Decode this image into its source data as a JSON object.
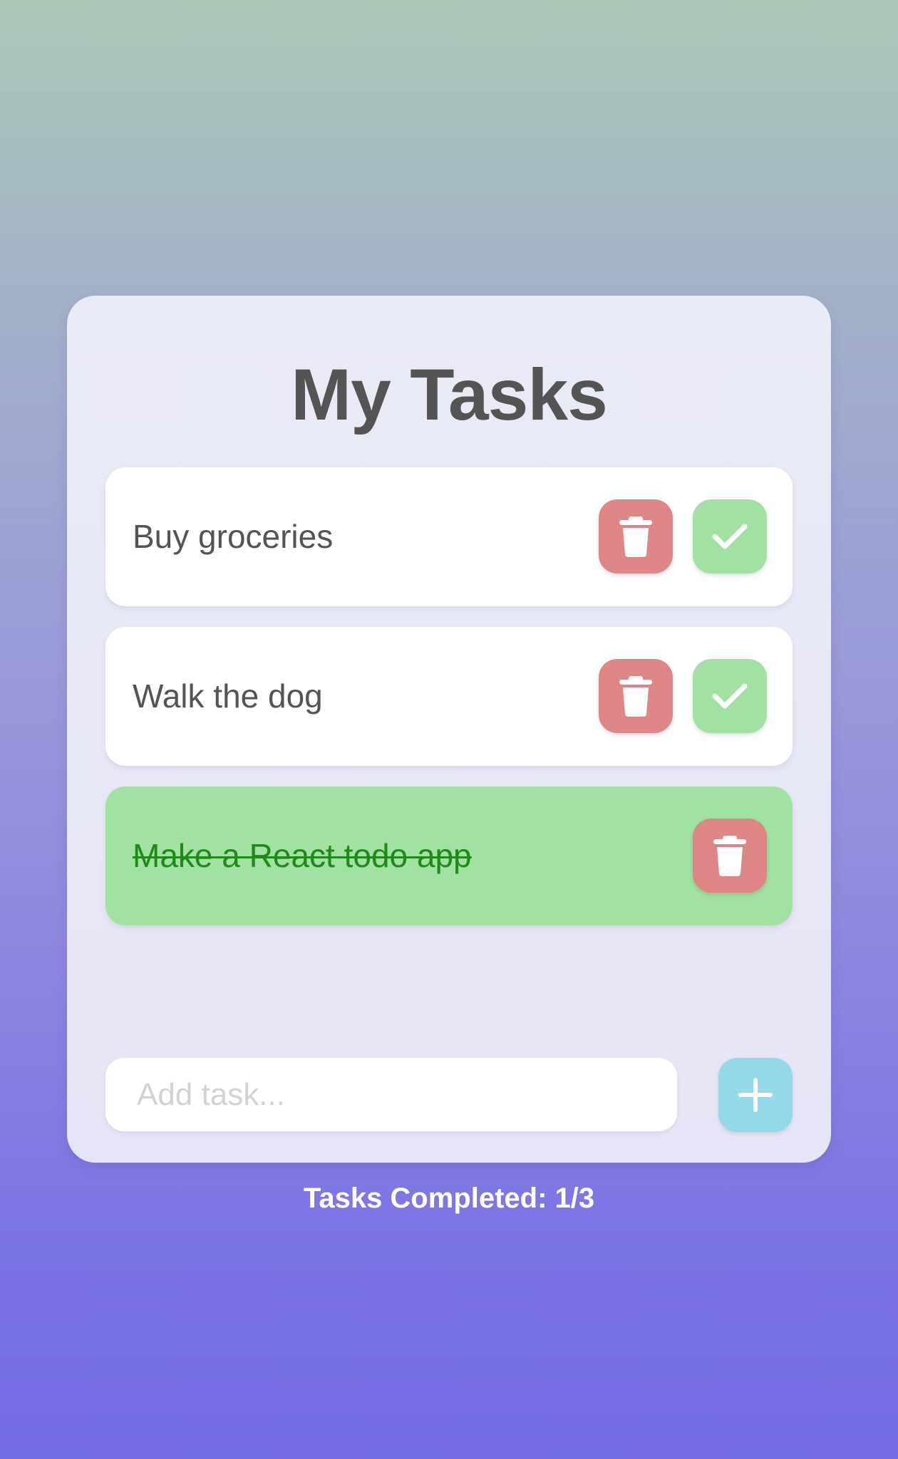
{
  "app": {
    "title": "My Tasks"
  },
  "tasks": [
    {
      "label": "Buy groceries",
      "completed": false
    },
    {
      "label": "Walk the dog",
      "completed": false
    },
    {
      "label": "Make a React todo app",
      "completed": true
    }
  ],
  "icons": {
    "delete": "trash-icon",
    "complete": "checkmark-icon",
    "add": "plus-icon"
  },
  "add_task": {
    "placeholder": "Add task...",
    "value": ""
  },
  "footer": {
    "counter": "Tasks Completed: 1/3"
  },
  "colors": {
    "card_bg": "#e9ebf6",
    "delete_button": "#de8585",
    "complete_button": "#a1e1a1",
    "completed_row": "#a1e1a1",
    "completed_text": "#1f8a1a",
    "add_button": "#93d9e8",
    "title_text": "#545454"
  }
}
